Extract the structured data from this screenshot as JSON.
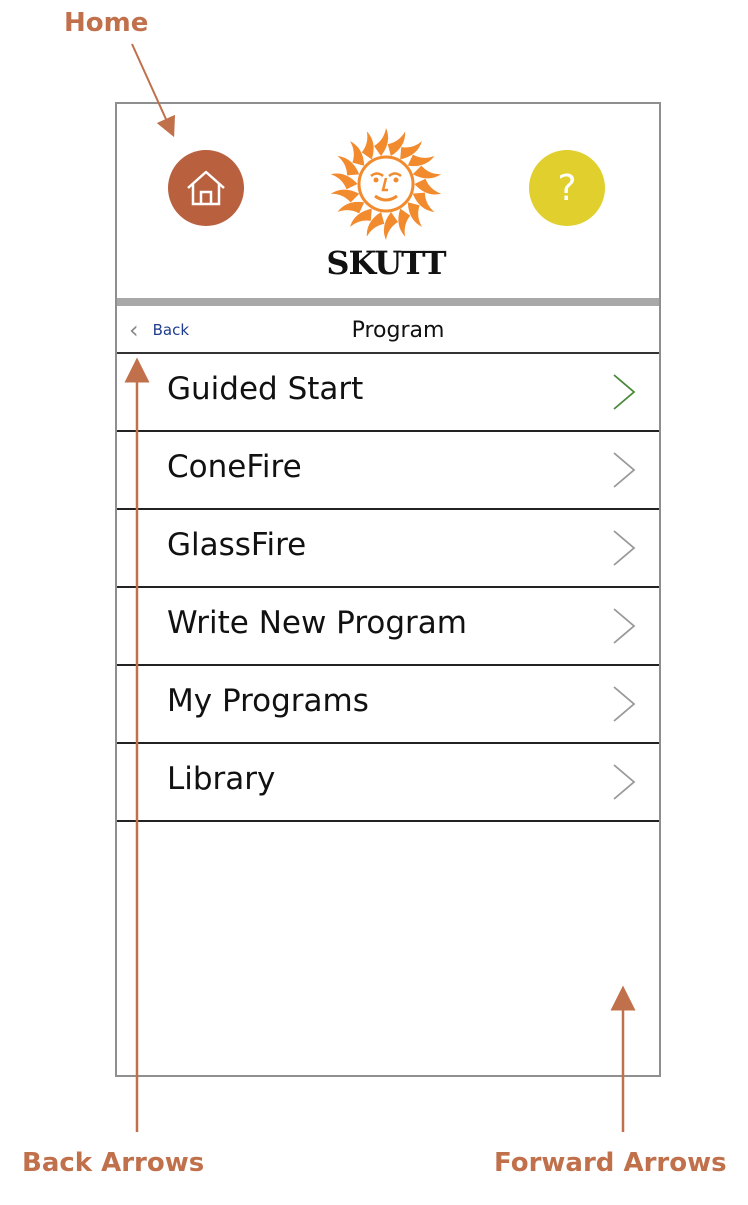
{
  "annotations": {
    "home": "Home",
    "back_arrows": "Back Arrows",
    "forward_arrows": "Forward Arrows"
  },
  "header": {
    "home_icon": "house-icon",
    "help_label": "?",
    "logo_text": "SKUTT",
    "colors": {
      "home": "#b9603f",
      "help": "#e0cf2c",
      "logo": "#f28a2e"
    }
  },
  "navbar": {
    "back_label": "Back",
    "back_icon": "chevron-left-icon",
    "title": "Program"
  },
  "menu": {
    "items": [
      {
        "label": "Guided Start",
        "chevron_color": "#4a8a3a"
      },
      {
        "label": "ConeFire",
        "chevron_color": "#999999"
      },
      {
        "label": "GlassFire",
        "chevron_color": "#999999"
      },
      {
        "label": "Write New Program",
        "chevron_color": "#999999"
      },
      {
        "label": "My Programs",
        "chevron_color": "#999999"
      },
      {
        "label": "Library",
        "chevron_color": "#999999"
      }
    ]
  }
}
